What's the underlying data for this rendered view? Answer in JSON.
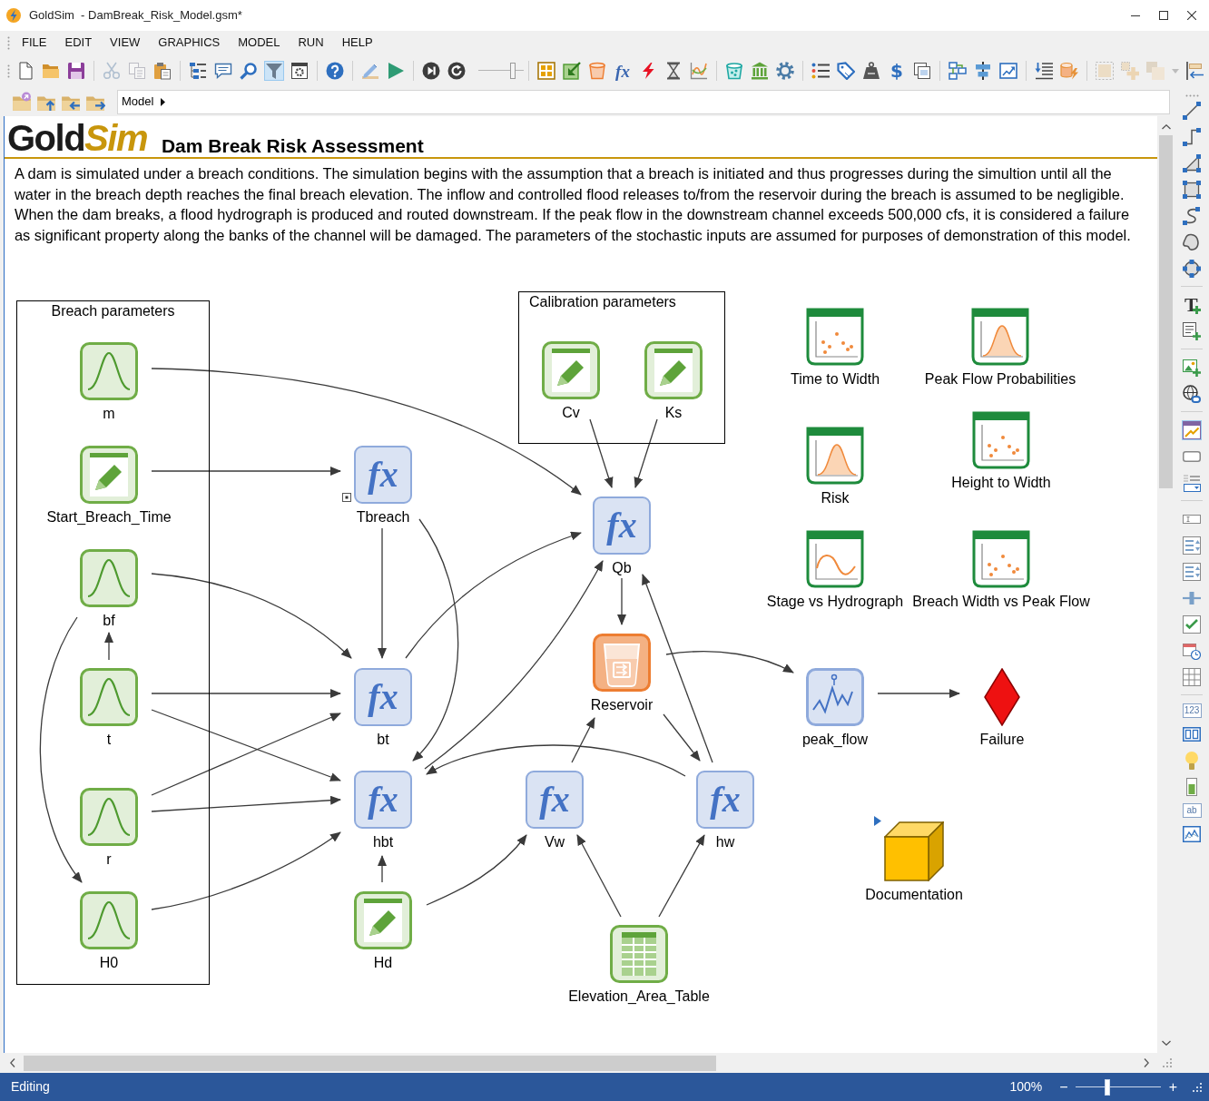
{
  "window": {
    "title": "GoldSim  - DamBreak_Risk_Model.gsm*"
  },
  "menu": [
    "FILE",
    "EDIT",
    "VIEW",
    "GRAPHICS",
    "MODEL",
    "RUN",
    "HELP"
  ],
  "toolbar": {
    "groups": [
      {
        "buttons": [
          {
            "kind": "new",
            "disabled": false,
            "selected": false
          },
          {
            "kind": "open",
            "disabled": false,
            "selected": false
          },
          {
            "kind": "save",
            "disabled": false,
            "selected": false
          }
        ]
      },
      {
        "buttons": [
          {
            "kind": "cut",
            "disabled": true,
            "selected": false
          },
          {
            "kind": "copy",
            "disabled": true,
            "selected": false
          },
          {
            "kind": "paste",
            "disabled": false,
            "selected": false
          }
        ]
      },
      {
        "buttons": [
          {
            "kind": "browser",
            "disabled": false,
            "selected": false
          },
          {
            "kind": "comment",
            "disabled": false,
            "selected": false
          },
          {
            "kind": "find",
            "disabled": false,
            "selected": false
          },
          {
            "kind": "filter",
            "disabled": false,
            "selected": true
          },
          {
            "kind": "options",
            "disabled": false,
            "selected": false
          }
        ]
      },
      {
        "buttons": [
          {
            "kind": "help",
            "disabled": false,
            "selected": false
          }
        ]
      },
      {
        "buttons": [
          {
            "kind": "edit",
            "disabled": false,
            "selected": false
          },
          {
            "kind": "run",
            "disabled": false,
            "selected": false
          }
        ]
      },
      {
        "buttons": [
          {
            "kind": "step",
            "disabled": false,
            "selected": false
          },
          {
            "kind": "reset",
            "disabled": false,
            "selected": false
          }
        ]
      },
      {
        "slider": {
          "level": 0.8
        }
      },
      {
        "buttons": [
          {
            "kind": "grid",
            "disabled": false,
            "selected": false
          },
          {
            "kind": "import",
            "disabled": false,
            "selected": false
          },
          {
            "kind": "bucket",
            "disabled": false,
            "selected": false
          },
          {
            "kind": "function",
            "glyph": "fx",
            "disabled": false,
            "selected": false
          },
          {
            "kind": "lightning",
            "disabled": false,
            "selected": false
          },
          {
            "kind": "hourglass",
            "disabled": false,
            "selected": false
          },
          {
            "kind": "chart",
            "disabled": false,
            "selected": false
          }
        ]
      },
      {
        "buttons": [
          {
            "kind": "pool",
            "disabled": false,
            "selected": false
          },
          {
            "kind": "bank",
            "disabled": false,
            "selected": false
          },
          {
            "kind": "gear",
            "disabled": false,
            "selected": false
          }
        ]
      },
      {
        "buttons": [
          {
            "kind": "list",
            "disabled": false,
            "selected": false
          },
          {
            "kind": "tag",
            "disabled": false,
            "selected": false
          },
          {
            "kind": "weight",
            "disabled": false,
            "selected": false
          },
          {
            "kind": "currency",
            "glyph": "$",
            "disabled": false,
            "selected": false
          },
          {
            "kind": "versions",
            "disabled": false,
            "selected": false
          }
        ]
      },
      {
        "buttons": [
          {
            "kind": "network",
            "disabled": false,
            "selected": false
          },
          {
            "kind": "align",
            "disabled": false,
            "selected": false
          },
          {
            "kind": "trend",
            "disabled": false,
            "selected": false
          }
        ]
      },
      {
        "buttons": [
          {
            "kind": "indent",
            "disabled": false,
            "selected": false
          },
          {
            "kind": "database",
            "disabled": false,
            "selected": false
          }
        ]
      },
      {
        "buttons": [
          {
            "kind": "frame",
            "disabled": true,
            "selected": false
          },
          {
            "kind": "groupadd",
            "disabled": true,
            "selected": false
          },
          {
            "kind": "stack",
            "disabled": true,
            "selected": false
          },
          {
            "kind": "dropdown",
            "disabled": true,
            "selected": false
          },
          {
            "kind": "alignleft",
            "disabled": false,
            "selected": false
          }
        ]
      }
    ]
  },
  "breadcrumb": {
    "path": "Model"
  },
  "drawing_toolbar": {
    "groups": [
      {
        "buttons": [
          {
            "kind": "line",
            "selected": false
          },
          {
            "kind": "elbow",
            "selected": false
          },
          {
            "kind": "triangle",
            "selected": false
          },
          {
            "kind": "rectangle",
            "selected": false
          },
          {
            "kind": "curve",
            "selected": false
          },
          {
            "kind": "blob",
            "selected": false
          },
          {
            "kind": "circle",
            "selected": false
          }
        ]
      },
      {
        "buttons": [
          {
            "kind": "text",
            "glyph": "T",
            "selected": false
          },
          {
            "kind": "textbox",
            "selected": false
          }
        ]
      },
      {
        "buttons": [
          {
            "kind": "image",
            "selected": false
          },
          {
            "kind": "hyperlink",
            "selected": false
          }
        ]
      },
      {
        "buttons": [
          {
            "kind": "dashboard",
            "selected": true
          },
          {
            "kind": "button",
            "selected": false
          },
          {
            "kind": "listbox",
            "selected": false
          }
        ]
      },
      {
        "buttons": [
          {
            "kind": "inputfield",
            "selected": false
          },
          {
            "kind": "listspin",
            "selected": false
          },
          {
            "kind": "listspin",
            "selected": false
          },
          {
            "kind": "slider",
            "selected": false
          },
          {
            "kind": "checkbox",
            "selected": false
          },
          {
            "kind": "calendar",
            "selected": false
          },
          {
            "kind": "grid",
            "selected": false
          }
        ]
      },
      {
        "buttons": [
          {
            "kind": "counter",
            "glyph": "123",
            "selected": false
          },
          {
            "kind": "display",
            "selected": false
          },
          {
            "kind": "bulb",
            "selected": false
          },
          {
            "kind": "gauge",
            "selected": false
          },
          {
            "kind": "label",
            "glyph": "ab",
            "selected": false
          },
          {
            "kind": "chart",
            "selected": false
          }
        ]
      }
    ]
  },
  "canvas": {
    "logo": [
      "Gold",
      "Sim"
    ],
    "title": "Dam Break Risk Assessment",
    "description": "A dam is simulated under a breach conditions. The simulation begins with the assumption that a breach is initiated and thus progresses during the simultion until all the water in the breach depth reaches the final breach elevation. The inflow and controlled flood releases to/from the reservoir during the breach is assumed to be negligible. When the dam breaks, a flood hydrograph is produced and routed downstream. If the peak flow in the downstream channel exceeds 500,000 cfs, it is considered a failure as significant property along the banks of the channel will be damaged. The parameters of the stochastic inputs are assumed for purposes of demonstration of this model.",
    "groups": [
      {
        "title": "Breach parameters"
      },
      {
        "title": "Calibration parameters"
      }
    ],
    "elements": [
      {
        "label": "m",
        "kind": "stochastic",
        "marker": false
      },
      {
        "label": "Start_Breach_Time",
        "kind": "data",
        "marker": false
      },
      {
        "label": "bf",
        "kind": "stochastic",
        "marker": false
      },
      {
        "label": "t",
        "kind": "stochastic",
        "marker": false
      },
      {
        "label": "r",
        "kind": "stochastic",
        "marker": false
      },
      {
        "label": "H0",
        "kind": "stochastic",
        "marker": false
      },
      {
        "label": "Cv",
        "kind": "data",
        "marker": false
      },
      {
        "label": "Ks",
        "kind": "data",
        "marker": false
      },
      {
        "label": "Tbreach",
        "kind": "expression",
        "glyph": "fx",
        "marker": true
      },
      {
        "label": "Qb",
        "kind": "expression",
        "glyph": "fx",
        "marker": false
      },
      {
        "label": "bt",
        "kind": "expression",
        "glyph": "fx",
        "marker": false
      },
      {
        "label": "hbt",
        "kind": "expression",
        "glyph": "fx",
        "marker": false
      },
      {
        "label": "Hd",
        "kind": "data",
        "marker": false
      },
      {
        "label": "Reservoir",
        "kind": "reservoir",
        "marker": false
      },
      {
        "label": "Vw",
        "kind": "expression",
        "glyph": "fx",
        "marker": false
      },
      {
        "label": "hw",
        "kind": "expression",
        "glyph": "fx",
        "marker": false
      },
      {
        "label": "Elevation_Area_Table",
        "kind": "lookup_table",
        "marker": false
      },
      {
        "label": "peak_flow",
        "kind": "time_history",
        "marker": false
      },
      {
        "label": "Failure",
        "kind": "status",
        "marker": false
      },
      {
        "label": "Documentation",
        "kind": "container",
        "marker": true
      },
      {
        "label": "Time to Width",
        "kind": "result_scatter",
        "marker": false
      },
      {
        "label": "Peak Flow Probabilities",
        "kind": "result_distribution",
        "marker": false
      },
      {
        "label": "Risk",
        "kind": "result_distribution",
        "marker": false
      },
      {
        "label": "Height to Width",
        "kind": "result_scatter",
        "marker": false
      },
      {
        "label": "Stage vs Hydrograph",
        "kind": "result_line",
        "marker": false
      },
      {
        "label": "Breach Width vs Peak Flow",
        "kind": "result_scatter",
        "marker": false
      }
    ]
  },
  "status_bar": {
    "mode": "Editing",
    "zoom": "100%",
    "zoom_out": "−",
    "zoom_in": "+",
    "zoom_slider": {
      "level": 0.37
    }
  }
}
